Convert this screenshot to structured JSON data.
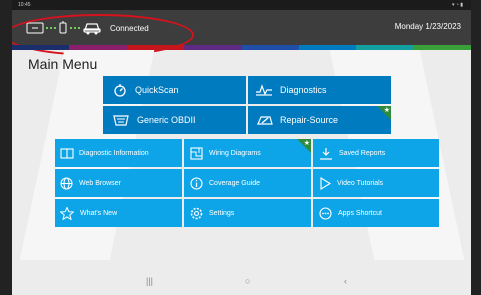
{
  "status_bar": {
    "time": "10:45",
    "system_icons": "signal-wifi-battery"
  },
  "header": {
    "connection_status": "Connected",
    "date": "Monday 1/23/2023"
  },
  "main_menu": {
    "title": "Main Menu",
    "primary_tiles": [
      {
        "label": "QuickScan",
        "icon": "quickscan-icon"
      },
      {
        "label": "Diagnostics",
        "icon": "diagnostics-icon"
      },
      {
        "label": "Generic OBDII",
        "icon": "obd-connector-icon"
      },
      {
        "label": "Repair-Source",
        "icon": "repair-source-icon",
        "badge": "new"
      }
    ],
    "secondary_tiles": [
      {
        "label": "Diagnostic Information",
        "icon": "book-icon"
      },
      {
        "label": "Wiring Diagrams",
        "icon": "wiring-icon",
        "badge": "new"
      },
      {
        "label": "Saved Reports",
        "icon": "download-icon"
      },
      {
        "label": "Web Browser",
        "icon": "globe-icon"
      },
      {
        "label": "Coverage Guide",
        "icon": "info-icon"
      },
      {
        "label": "Video Tutorials",
        "icon": "play-icon"
      },
      {
        "label": "What's New",
        "icon": "star-icon"
      },
      {
        "label": "Settings",
        "icon": "settings-icon"
      },
      {
        "label": "Apps Shortcut",
        "icon": "apps-icon"
      }
    ]
  },
  "nav_bar": {
    "recents": "|||",
    "home": "○",
    "back": "‹"
  },
  "colors": {
    "primary_tile": "#007bc0",
    "secondary_tile": "#0ea5e8",
    "badge": "#2e8b3e",
    "header": "#3d3d3d",
    "connected_dots": "#6fcf5a",
    "annotation_circle": "#d6121d",
    "brand_stripe": [
      "#1a2e6c",
      "#8a1f6c",
      "#c4161c",
      "#5e2a84",
      "#1f4fa8",
      "#007bc0",
      "#12a0a0",
      "#3aa03a"
    ]
  }
}
